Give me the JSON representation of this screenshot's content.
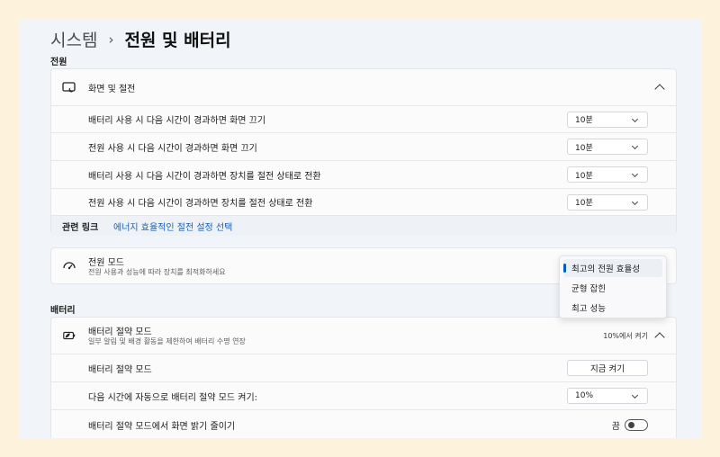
{
  "breadcrumb": {
    "parent": "시스템",
    "separator": "›",
    "current": "전원 및 배터리"
  },
  "power": {
    "section_title": "전원",
    "screen_sleep": {
      "title": "화면 및 절전",
      "rows": [
        {
          "label": "배터리 사용 시 다음 시간이 경과하면 화면 끄기",
          "value": "10분"
        },
        {
          "label": "전원 사용 시 다음 시간이 경과하면 화면 끄기",
          "value": "10분"
        },
        {
          "label": "배터리 사용 시 다음 시간이 경과하면 장치를 절전 상태로 전환",
          "value": "10분"
        },
        {
          "label": "전원 사용 시 다음 시간이 경과하면 장치를 절전 상태로 전환",
          "value": "10분"
        }
      ],
      "related_title": "관련 링크",
      "related_link": "에너지 효율적인 절전 설정 선택"
    },
    "power_mode": {
      "title": "전원 모드",
      "subtitle": "전원 사용과 성능에 따라 장치를 최적화하세요",
      "options": [
        "최고의 전원 효율성",
        "균형 잡힌",
        "최고 성능"
      ],
      "selected_index": 0
    }
  },
  "battery": {
    "section_title": "배터리",
    "saver": {
      "title": "배터리 절약 모드",
      "subtitle": "일부 알림 및 배경 활동을 제한하여 배터리 수명 연장",
      "status": "10%에서 켜기",
      "rows": {
        "saver_label": "배터리 절약 모드",
        "saver_button": "지금 켜기",
        "auto_label": "다음 시간에 자동으로 배터리 절약 모드 켜기:",
        "auto_value": "10%",
        "brightness_label": "배터리 절약 모드에서 화면 밝기 줄이기",
        "brightness_state": "끔"
      }
    }
  },
  "colors": {
    "accent": "#005fb8",
    "link": "#1a5fb4",
    "background": "#f1f4f9",
    "card": "#fbfbfc"
  }
}
